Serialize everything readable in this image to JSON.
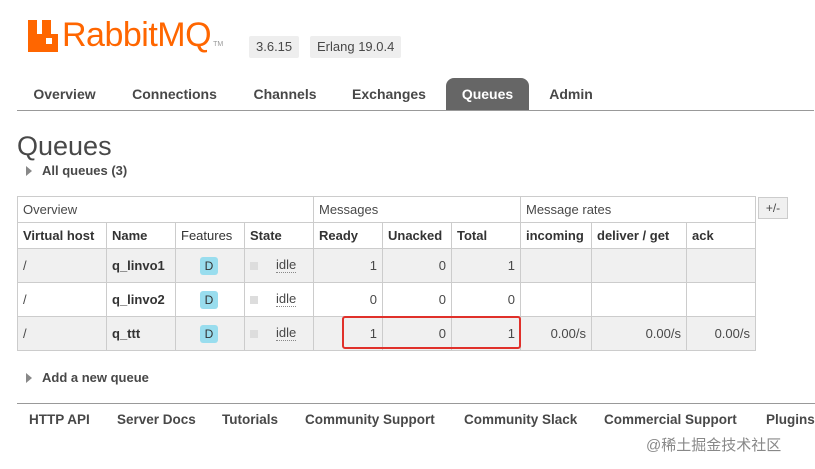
{
  "brand": {
    "name": "RabbitMQ",
    "tm": "TM",
    "color": "#ff6600"
  },
  "versions": {
    "rabbitmq": "3.6.15",
    "erlang": "Erlang 19.0.4"
  },
  "nav": {
    "tabs": [
      {
        "label": "Overview"
      },
      {
        "label": "Connections"
      },
      {
        "label": "Channels"
      },
      {
        "label": "Exchanges"
      },
      {
        "label": "Queues",
        "active": true
      },
      {
        "label": "Admin"
      }
    ]
  },
  "page": {
    "title": "Queues",
    "all_queues": "All queues (3)",
    "add_queue": "Add a new queue"
  },
  "table": {
    "groups": {
      "overview": "Overview",
      "messages": "Messages",
      "rates": "Message rates",
      "toggle": "+/-"
    },
    "columns": [
      "Virtual host",
      "Name",
      "Features",
      "State",
      "Ready",
      "Unacked",
      "Total",
      "incoming",
      "deliver / get",
      "ack"
    ],
    "rows": [
      {
        "vhost": "/",
        "name": "q_linvo1",
        "feature": "D",
        "state": "idle",
        "ready": "1",
        "unacked": "0",
        "total": "1",
        "incoming": "",
        "deliver": "",
        "ack": ""
      },
      {
        "vhost": "/",
        "name": "q_linvo2",
        "feature": "D",
        "state": "idle",
        "ready": "0",
        "unacked": "0",
        "total": "0",
        "incoming": "",
        "deliver": "",
        "ack": ""
      },
      {
        "vhost": "/",
        "name": "q_ttt",
        "feature": "D",
        "state": "idle",
        "ready": "1",
        "unacked": "0",
        "total": "1",
        "incoming": "0.00/s",
        "deliver": "0.00/s",
        "ack": "0.00/s"
      }
    ]
  },
  "footer": {
    "links": [
      "HTTP API",
      "Server Docs",
      "Tutorials",
      "Community Support",
      "Community Slack",
      "Commercial Support",
      "Plugins"
    ]
  },
  "watermark": "@稀土掘金技术社区"
}
